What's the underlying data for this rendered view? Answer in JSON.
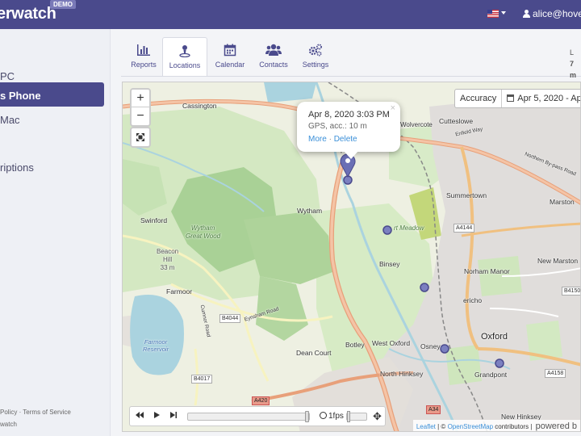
{
  "header": {
    "brand": "erwatch",
    "demo_badge": "DEMO",
    "user": "alice@hover"
  },
  "sidebar": {
    "items": [
      {
        "label": "PC"
      },
      {
        "label": "s Phone"
      },
      {
        "label": "Mac"
      },
      {
        "label": ""
      },
      {
        "label": "riptions"
      }
    ],
    "footer_links": "Policy · Terms of Service",
    "footer_brand": "watch"
  },
  "tabs": [
    {
      "label": "Reports",
      "icon": "bar-chart-icon"
    },
    {
      "label": "Locations",
      "icon": "location-pin-icon"
    },
    {
      "label": "Calendar",
      "icon": "calendar-icon"
    },
    {
      "label": "Contacts",
      "icon": "contacts-icon"
    },
    {
      "label": "Settings",
      "icon": "gears-icon"
    }
  ],
  "last_info": {
    "line1": "L",
    "line2": "7 m"
  },
  "map": {
    "accuracy_label": "Accuracy",
    "date_range": "Apr 5, 2020 - Apr",
    "zoom_in": "+",
    "zoom_out": "−",
    "popup": {
      "title": "Apr 8, 2020 3:03 PM",
      "subtitle": "GPS, acc.: 10 m",
      "more": "More",
      "sep": "·",
      "delete": "Delete",
      "close": "×"
    },
    "player": {
      "fps": "1fps"
    },
    "attribution": {
      "leaflet": "Leaflet",
      "sep": "|",
      "osm": "OpenStreetMap",
      "contributors": "contributors |",
      "powered": "powered b"
    },
    "places": {
      "cassington": "Cassington",
      "cutteslowe": "Cutteslowe",
      "wolvercote": "Wolvercote",
      "upper_wolvercote": "per Wolvercote",
      "summertown": "Summertown",
      "marston": "Marston",
      "swinford": "Swinford",
      "wytham": "Wytham",
      "wytham_wood_1": "Wytham",
      "wytham_wood_2": "Great Wood",
      "beacon_1": "Beacon",
      "beacon_2": "Hill",
      "beacon_3": "33 m",
      "port_meadow": "rt Meadow",
      "binsey": "Binsey",
      "norham_manor": "Norham Manor",
      "new_marston": "New Marston",
      "farmoor": "Farmoor",
      "jericho": "ericho",
      "farmoor_res_1": "Farmoor",
      "farmoor_res_2": "Reservoir",
      "oxford": "Oxford",
      "osney": "Osney",
      "botley": "Botley",
      "west_oxford": "West Oxford",
      "dean_court": "Dean Court",
      "north_hinksey": "North Hinksey",
      "grandpont": "Grandpont",
      "new_hinksey": "New Hinksey",
      "enfield_way": "Enfield Way",
      "northern_bypass": "Northern By-pass Road",
      "cumnor_road": "Cumnor Road",
      "eynsham_road": "Eynsham Road",
      "roads": {
        "a4144": "A4144",
        "b4150": "B4150",
        "b4044": "B4044",
        "b4017": "B4017",
        "a420": "A420",
        "a34": "A34",
        "a4158": "A4158"
      }
    }
  }
}
